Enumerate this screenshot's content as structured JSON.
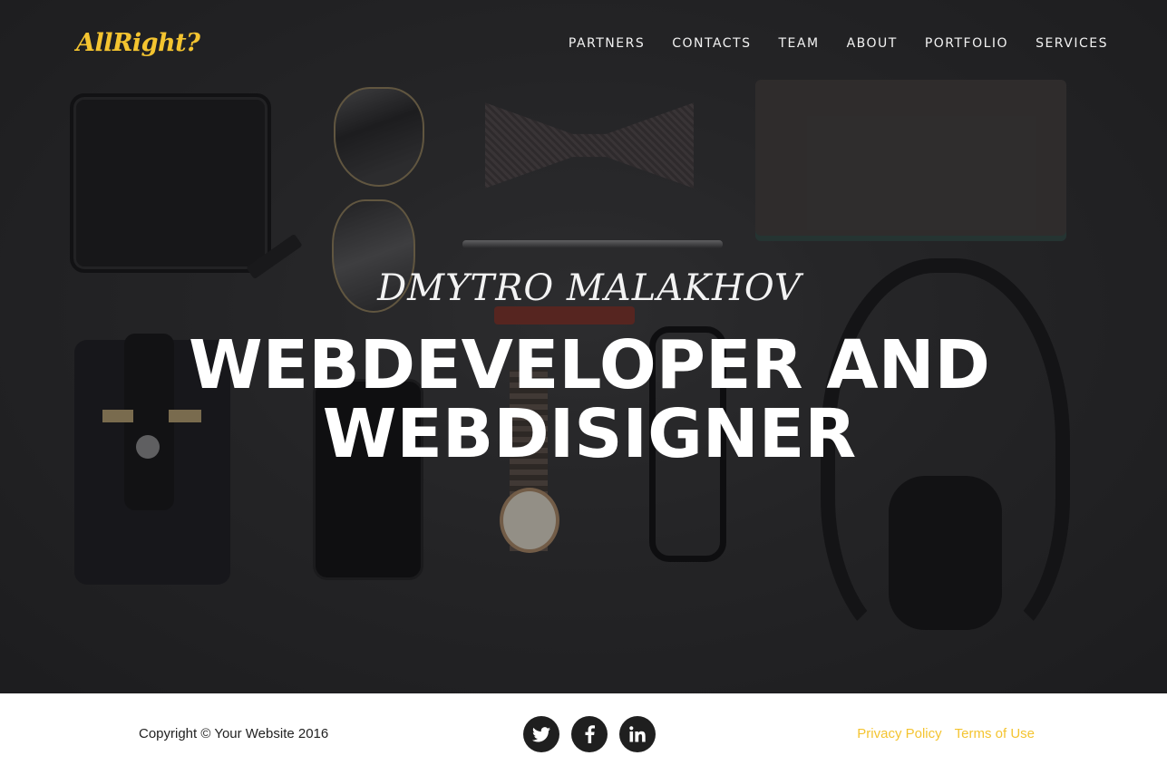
{
  "brand": {
    "logo_text": "AllRight?",
    "accent_color": "#f4c430"
  },
  "nav": {
    "items": [
      {
        "label": "PARTNERS"
      },
      {
        "label": "CONTACTS"
      },
      {
        "label": "TEAM"
      },
      {
        "label": "ABOUT"
      },
      {
        "label": "PORTFOLIO"
      },
      {
        "label": "SERVICES"
      }
    ]
  },
  "hero": {
    "subtitle": "DMYTRO MALAKHOV",
    "headline_line1": "WEBDEVELOPER AND",
    "headline_line2": "WEBDISIGNER"
  },
  "footer": {
    "copyright": "Copyright © Your Website 2016",
    "social": [
      {
        "icon": "twitter-icon"
      },
      {
        "icon": "facebook-icon"
      },
      {
        "icon": "linkedin-icon"
      }
    ],
    "links": [
      {
        "label": "Privacy Policy"
      },
      {
        "label": "Terms of Use"
      }
    ]
  }
}
